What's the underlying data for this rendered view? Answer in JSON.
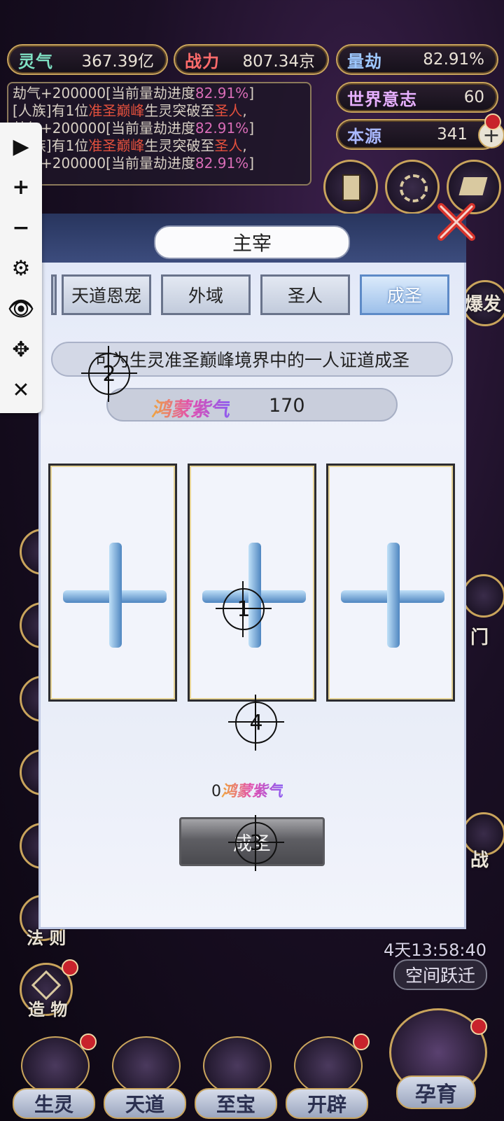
{
  "resources": {
    "lingqi_label": "灵气",
    "lingqi_value": "367.39亿",
    "zhanli_label": "战力",
    "zhanli_value": "807.34京",
    "liangjie_label": "量劫",
    "liangjie_value": "82.91%",
    "shijie_label": "世界意志",
    "shijie_value": "60",
    "benyuan_label": "本源",
    "benyuan_value": "341"
  },
  "log": {
    "line1_prefix": "劫气+200000[当前量劫进度",
    "line1_pct": "82.91%",
    "line1_suffix": "]",
    "line2_a": "[人族]有1位",
    "line2_red1": "准圣巅峰",
    "line2_b": "生灵突破至",
    "line2_red2": "圣人",
    "line2_c": ",",
    "line3_prefix": "劫气+200000[当前量劫进度",
    "line3_pct": "82.91%",
    "line3_suffix": "]",
    "line4_a": "[人族]有1位",
    "line4_red1": "准圣巅峰",
    "line4_b": "生灵突破至",
    "line4_red2": "圣人",
    "line4_c": ",",
    "line5_prefix": "劫气+200000[当前量劫进度",
    "line5_pct": "82.91%",
    "line5_suffix": "]"
  },
  "toolbar": {
    "play": "▶",
    "zoom_in": "+",
    "zoom_out": "−",
    "settings": "⚙",
    "hide": "👁",
    "move": "✥",
    "close": "✕"
  },
  "panel": {
    "title": "主宰",
    "tabs": [
      "天道恩宠",
      "外域",
      "圣人",
      "成圣"
    ],
    "active_tab": "成圣",
    "description": "可为生灵准圣巅峰境界中的一人证道成圣",
    "currency_name": "鸿蒙紫气",
    "currency_value": "170",
    "cost_value": "0",
    "cost_name": "鸿蒙紫气",
    "action_button": "成圣"
  },
  "markers": {
    "m1": "1",
    "m2": "2",
    "m3": "3",
    "m4": "4"
  },
  "side_labels": {
    "right_baofa": "爆发",
    "right_men": "门",
    "right_zhan": "战",
    "fa_ze": "法 则",
    "zao_wu": "造 物"
  },
  "timer": {
    "countdown": "4天13:58:40",
    "jump_label": "空间跃迁"
  },
  "bottom_nav": [
    "生灵",
    "天道",
    "至宝",
    "开辟",
    "孕育"
  ],
  "colors": {
    "accent_gold": "#c9a45c",
    "red_text": "#e2503d",
    "pink_text": "#d86cb6",
    "active_tab": "#9dc0ea"
  }
}
